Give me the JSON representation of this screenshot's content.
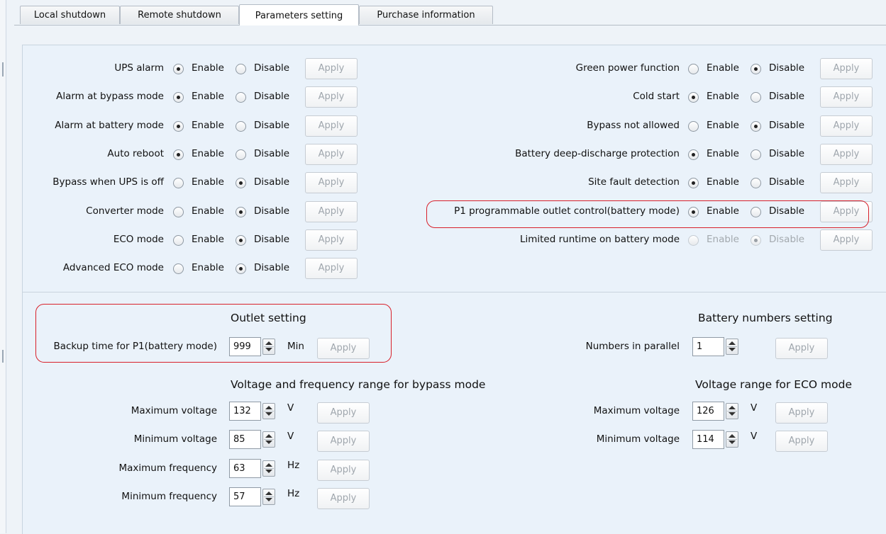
{
  "tabs": [
    {
      "label": "Local shutdown",
      "active": false
    },
    {
      "label": "Remote shutdown",
      "active": false
    },
    {
      "label": "Parameters setting",
      "active": true
    },
    {
      "label": "Purchase information",
      "active": false
    }
  ],
  "options": {
    "enable_label": "Enable",
    "disable_label": "Disable",
    "apply_label": "Apply",
    "left": [
      {
        "label": "UPS alarm",
        "value": "Enable"
      },
      {
        "label": "Alarm at bypass mode",
        "value": "Enable"
      },
      {
        "label": "Alarm at battery mode",
        "value": "Enable"
      },
      {
        "label": "Auto reboot",
        "value": "Enable"
      },
      {
        "label": "Bypass when UPS is off",
        "value": "Disable"
      },
      {
        "label": "Converter mode",
        "value": "Disable"
      },
      {
        "label": "ECO mode",
        "value": "Disable"
      },
      {
        "label": "Advanced ECO mode",
        "value": "Disable"
      }
    ],
    "right": [
      {
        "label": "Green power function",
        "value": "Disable"
      },
      {
        "label": "Cold start",
        "value": "Enable"
      },
      {
        "label": "Bypass not allowed",
        "value": "Disable"
      },
      {
        "label": "Battery deep-discharge protection",
        "value": "Enable"
      },
      {
        "label": "Site fault detection",
        "value": "Enable"
      },
      {
        "label": "P1 programmable outlet control(battery mode)",
        "value": "Enable",
        "highlighted": true
      },
      {
        "label": "Limited runtime on battery mode",
        "value": "Disable",
        "disabled": true
      }
    ]
  },
  "outlet": {
    "title": "Outlet setting",
    "label": "Backup time for P1(battery mode)",
    "value": "999",
    "unit": "Min"
  },
  "battery": {
    "title": "Battery numbers setting",
    "label": "Numbers in parallel",
    "value": "1"
  },
  "bypass_range": {
    "title": "Voltage and frequency range for bypass modе",
    "rows": [
      {
        "label": "Maximum voltage",
        "value": "132",
        "unit": "V"
      },
      {
        "label": "Minimum voltage",
        "value": "85",
        "unit": "V"
      },
      {
        "label": "Maximum frequency",
        "value": "63",
        "unit": "Hz"
      },
      {
        "label": "Minimum frequency",
        "value": "57",
        "unit": "Hz"
      }
    ]
  },
  "eco_range": {
    "title": "Voltage range for ECO mode",
    "rows": [
      {
        "label": "Maximum voltage",
        "value": "126",
        "unit": "V"
      },
      {
        "label": "Minimum voltage",
        "value": "114",
        "unit": "V"
      }
    ]
  },
  "colors": {
    "highlight": "#d8202a",
    "panel": "#eaf2fa"
  }
}
